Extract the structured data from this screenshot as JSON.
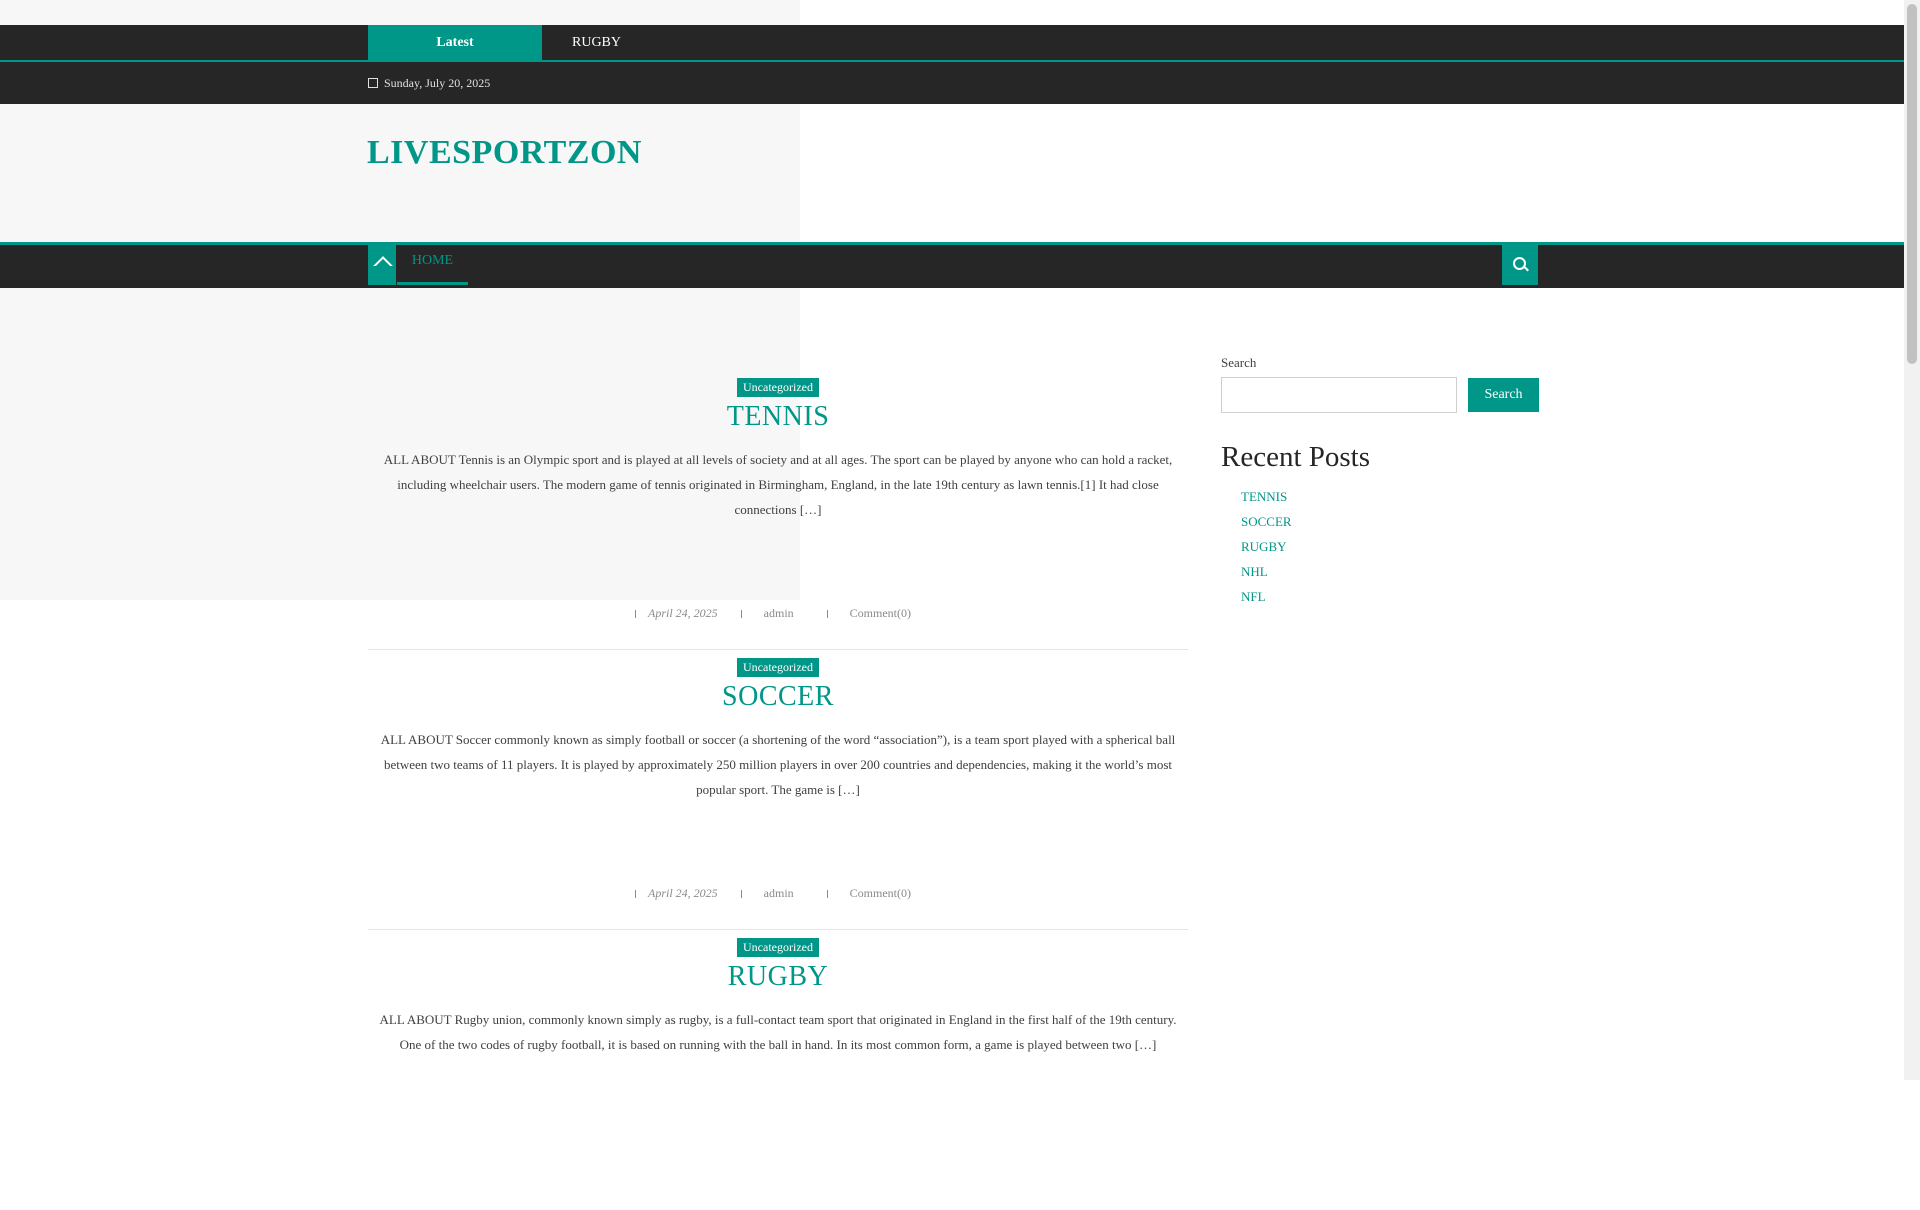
{
  "ticker": {
    "label": "Latest",
    "item": "RUGBY"
  },
  "date": "Sunday, July 20, 2025",
  "site": {
    "logo": "LIVESPORTZON"
  },
  "nav": {
    "home": "HOME"
  },
  "posts": [
    {
      "category": "Uncategorized",
      "title": "TENNIS",
      "excerpt": "ALL ABOUT Tennis is an Olympic sport and is played at all levels of society and at all ages. The sport can be played by anyone who can hold a racket, including wheelchair users. The modern game of tennis originated in Birmingham, England, in the late 19th century as lawn tennis.[1] It had close connections […]",
      "date": "April 24, 2025",
      "author": "admin",
      "comments": "Comment(0)"
    },
    {
      "category": "Uncategorized",
      "title": "SOCCER",
      "excerpt": "ALL ABOUT Soccer commonly known as simply football or soccer (a shortening of the word “association”), is a team sport played with a spherical ball between two teams of 11 players. It is played by approximately 250 million players in over 200 countries and dependencies, making it the world’s most popular sport. The game is […]",
      "date": "April 24, 2025",
      "author": "admin",
      "comments": "Comment(0)"
    },
    {
      "category": "Uncategorized",
      "title": "RUGBY",
      "excerpt": "ALL ABOUT Rugby union, commonly known simply as rugby, is a full-contact team sport that originated in England in the first half of the 19th century. One of the two codes of rugby football, it is based on running with the ball in hand. In its most common form, a game is played between two […]",
      "date": "",
      "author": "",
      "comments": ""
    }
  ],
  "sidebar": {
    "search_label": "Search",
    "search_value": "",
    "search_button": "Search",
    "recent_title": "Recent Posts",
    "recent": [
      "TENNIS",
      "SOCCER",
      "RUGBY",
      "NHL",
      "NFL"
    ]
  },
  "colors": {
    "accent": "#009688",
    "dark": "#262626"
  },
  "icons": {
    "date": "calendar-icon",
    "home": "home-icon",
    "search": "search-icon"
  }
}
